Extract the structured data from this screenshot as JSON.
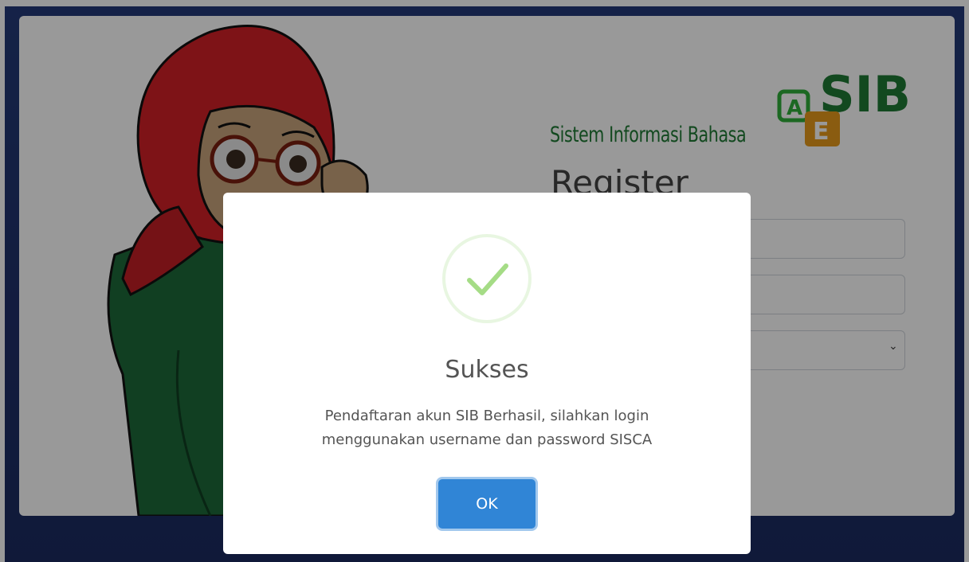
{
  "logo": {
    "text": "Sistem Informasi Bahasa",
    "mark_text": "SIB",
    "badge_a": "A",
    "badge_e": "E",
    "brand_green": "#1f7a35",
    "badge_orange": "#e69a1c",
    "badge_green": "#2fae3a"
  },
  "register": {
    "title": "Register"
  },
  "modal": {
    "icon": "check-icon",
    "title": "Sukses",
    "message": "Pendaftaran akun SIB Berhasil, silahkan login menggunakan username dan password SISCA",
    "ok_label": "OK",
    "accent": "#3085d6",
    "success_color": "#a5dc86"
  }
}
